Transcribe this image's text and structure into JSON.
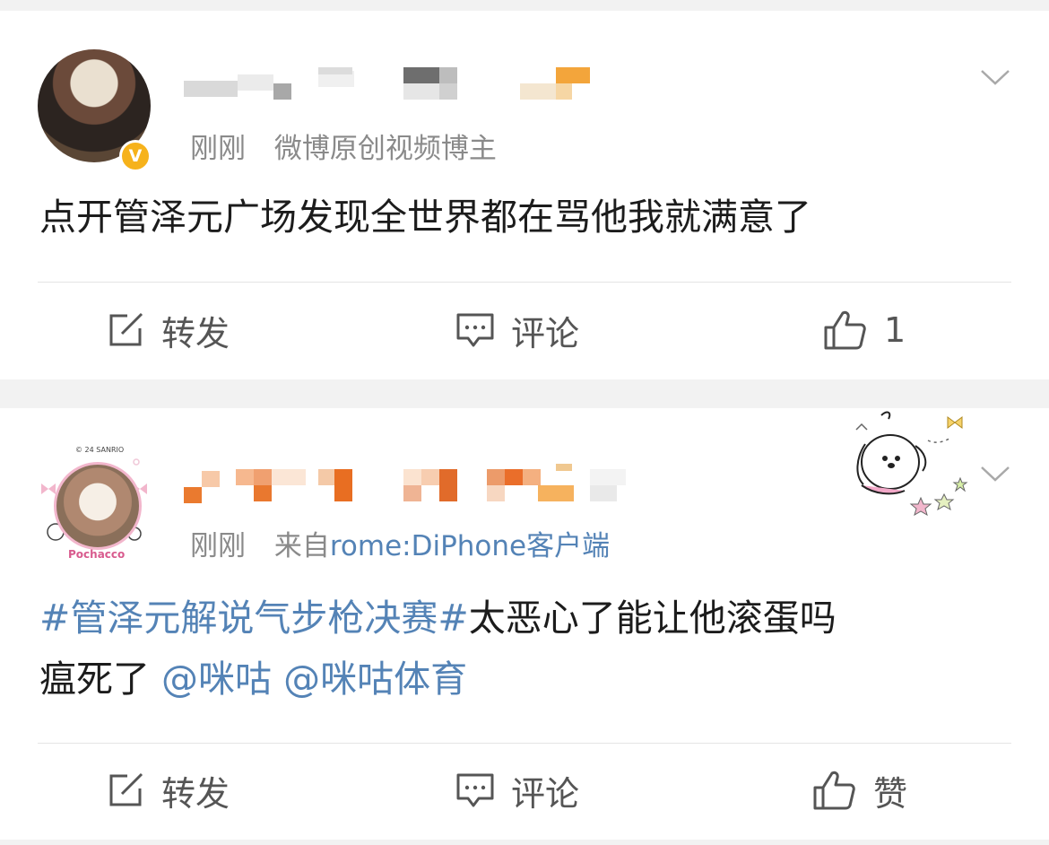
{
  "posts": [
    {
      "time": "刚刚",
      "source_text": "微博原创视频博主",
      "verified_badge": "V",
      "content": "点开管泽元广场发现全世界都在骂他我就满意了",
      "actions": {
        "repost": "转发",
        "comment": "评论",
        "like": "1"
      }
    },
    {
      "time": "刚刚",
      "source_prefix": "来自",
      "source_text": "rome:DiPhone客户端",
      "avatar_text": "Pochacco",
      "avatar_small_text": "© 24 SANRIO",
      "content_topic": "#管泽元解说气步枪决赛#",
      "content_line1": "太恶心了能让他滚蛋吗",
      "content_line2": "瘟死了",
      "mentions": [
        "@咪咕",
        "@咪咕体育"
      ],
      "actions": {
        "repost": "转发",
        "comment": "评论",
        "like": "赞"
      }
    }
  ],
  "colors": {
    "link": "#5483b6",
    "meta": "#8a8a8a",
    "badge": "#f6b21b",
    "background": "#f2f2f2"
  },
  "icons": [
    "chevron-down-icon",
    "repost-icon",
    "comment-icon",
    "like-icon",
    "verified-badge-icon"
  ]
}
